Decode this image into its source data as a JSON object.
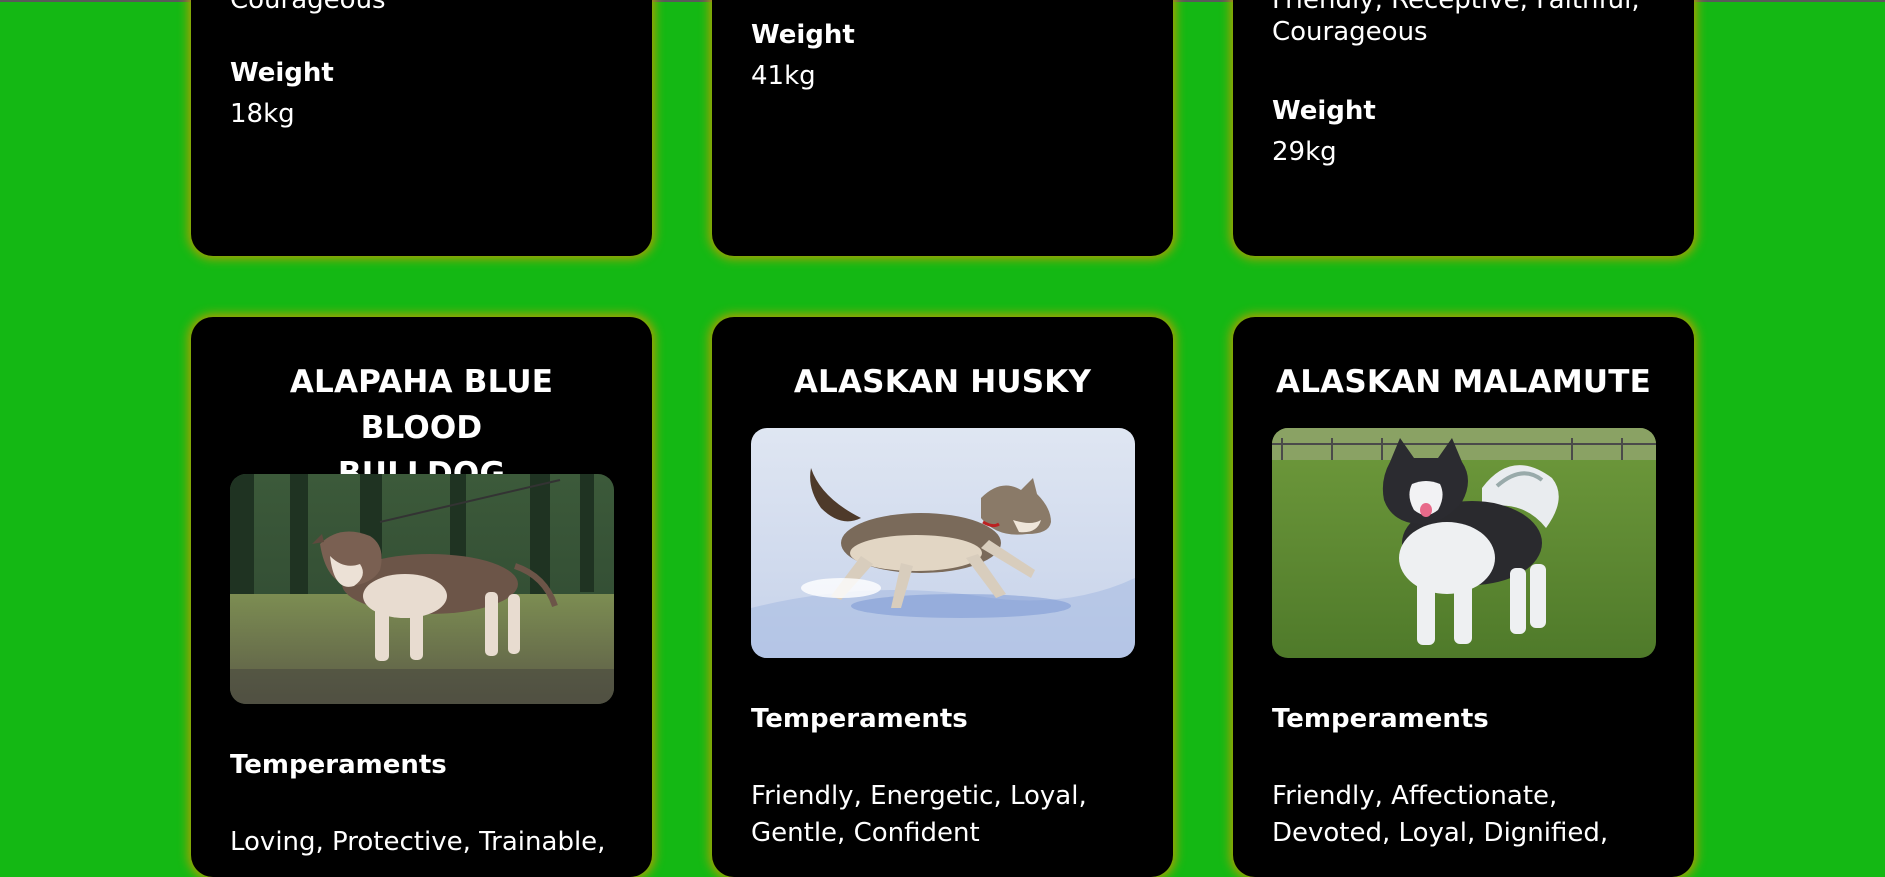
{
  "top_row": [
    {
      "temperaments_tail": "Courageous",
      "weight_label": "Weight",
      "weight_value": "18kg"
    },
    {
      "weight_label": "Weight",
      "weight_value": "41kg"
    },
    {
      "temperaments_line1": "Friendly, Receptive, Faithful,",
      "temperaments_line2": "Courageous",
      "weight_label": "Weight",
      "weight_value": "29kg"
    }
  ],
  "bottom_row": [
    {
      "title_line1": "ALAPAHA BLUE BLOOD",
      "title_line2": "BULLDOG",
      "image_icon": "dog-photo-alapaha",
      "temperaments_label": "Temperaments",
      "temperaments_line1": "Loving, Protective, Trainable,"
    },
    {
      "title_line1": "ALASKAN HUSKY",
      "image_icon": "dog-photo-husky",
      "temperaments_label": "Temperaments",
      "temperaments_line1": "Friendly, Energetic, Loyal,",
      "temperaments_line2": "Gentle, Confident"
    },
    {
      "title_line1": "ALASKAN MALAMUTE",
      "image_icon": "dog-photo-malamute",
      "temperaments_label": "Temperaments",
      "temperaments_line1": "Friendly, Affectionate,",
      "temperaments_line2": "Devoted, Loyal, Dignified,"
    }
  ]
}
